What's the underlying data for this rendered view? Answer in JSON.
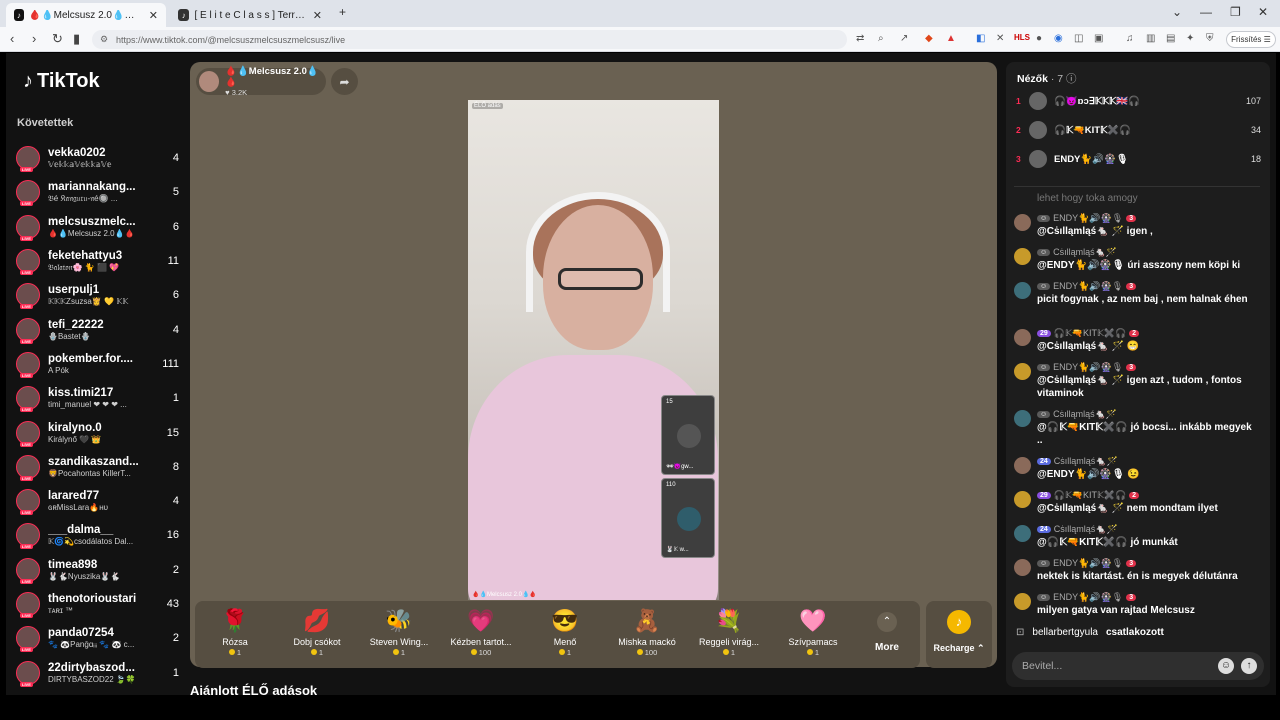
{
  "browser": {
    "tabs": [
      {
        "title": "🩸💧Melcsusz 2.0💧🩸 (@mel",
        "active": true
      },
      {
        "title": "[ E l i t e  C l a s s ] TerrorM",
        "active": false
      }
    ],
    "new_tab": "+",
    "url": "https://www.tiktok.com/@melcsuszmelcsuszmelcsusz/live",
    "update_button": "Frissítés"
  },
  "sidebar": {
    "logo": "TikTok",
    "following_header": "Követettek",
    "items": [
      {
        "name": "vekka0202",
        "sub": "𝕍𝕖𝕜𝕜𝕒𝕍𝕖𝕜𝕜𝕒𝕍𝕖",
        "count": "4"
      },
      {
        "name": "mariannakang...",
        "sub": "𝔅é 𝔎𝔞𝔫𝔤𝔲𝔯𝔲-𝔫é🔘 ...",
        "count": "5"
      },
      {
        "name": "melcsuszmelc...",
        "sub": "🩸💧Melcsusz 2.0💧🩸",
        "count": "6"
      },
      {
        "name": "feketehattyu3",
        "sub": "𝔅𝔞𝔩𝔞𝔱𝔬𝔫🌸 🐈 ⬛ 💖",
        "count": "11"
      },
      {
        "name": "userpulj1",
        "sub": "𝕂𝕂𝕂Zsuzsa👸 💛 𝕂𝕂",
        "count": "6"
      },
      {
        "name": "tefi_22222",
        "sub": "🪬Bastet🪬",
        "count": "4"
      },
      {
        "name": "pokember.for....",
        "sub": "A Pók",
        "count": "111"
      },
      {
        "name": "kiss.timi217",
        "sub": "timi_manuel ❤ ❤ ❤ ...",
        "count": "1"
      },
      {
        "name": "kiralyno.0",
        "sub": "Királynő 🖤 👑",
        "count": "15"
      },
      {
        "name": "szandikaszand...",
        "sub": "🦁Pocahontas KillerT...",
        "count": "8"
      },
      {
        "name": "larared77",
        "sub": "ɢʀMissLara🔥ʜᴜ",
        "count": "4"
      },
      {
        "name": "___dalma__",
        "sub": "𝕂🌀💫csodálatos Dal...",
        "count": "16"
      },
      {
        "name": "timea898",
        "sub": "🐰🐇Nyuszika🐰🐇",
        "count": "2"
      },
      {
        "name": "thenotorioustari",
        "sub": "ᴛᴀʀɪ ™",
        "count": "43"
      },
      {
        "name": "panda07254",
        "sub": "🐾 🐼Panḡɑᵢᵢᵢ 🐾 🐼 c...",
        "count": "2"
      },
      {
        "name": "22dirtybaszod...",
        "sub": "DIRTYBASZOD22 🍃🍀",
        "count": "1"
      }
    ]
  },
  "stream": {
    "host_name": "🩸💧Melcsusz 2.0💧🩸",
    "host_likes": "3.2K",
    "video_label": "ÉLŐ adás",
    "video_caption": "🩸💧Melcsusz 2.0💧🩸",
    "guests": [
      {
        "count": "15",
        "name": "🕶😈gw..."
      },
      {
        "count": "110",
        "name": "🐰𝕂 w..."
      }
    ]
  },
  "gifts": [
    {
      "label": "Rózsa",
      "price": "1",
      "icon": "🌹"
    },
    {
      "label": "Dobj csókot",
      "price": "1",
      "icon": "💋"
    },
    {
      "label": "Steven Wing...",
      "price": "1",
      "icon": "🐝"
    },
    {
      "label": "Kézben tartot...",
      "price": "100",
      "icon": "💗"
    },
    {
      "label": "Menő",
      "price": "1",
      "icon": "😎"
    },
    {
      "label": "Mishka mackó",
      "price": "100",
      "icon": "🧸"
    },
    {
      "label": "Reggeli virág...",
      "price": "1",
      "icon": "💐"
    },
    {
      "label": "Szívpamacs",
      "price": "1",
      "icon": "🩷"
    }
  ],
  "more_label": "More",
  "recharge_label": "Recharge",
  "recommended": "Ajánlott ÉLŐ adások",
  "chat": {
    "viewers_label": "Nézők",
    "viewers_count": "· 7",
    "top_viewers": [
      {
        "rank": "1",
        "name": "🎧😈ɒɔ∃𝕂𝕂𝕂🇬🇧🎧",
        "score": "107"
      },
      {
        "rank": "2",
        "name": "🎧𝕂🔫KIT𝕂✖️🎧",
        "score": "34"
      },
      {
        "rank": "3",
        "name": "ENDY🐈🔊🎡🎙",
        "score": "18"
      }
    ],
    "faded_line": "lehet hogy toka amogy",
    "messages": [
      {
        "user": "ENDY🐈🔊🎡🎙",
        "lvl": "",
        "fan": "3",
        "text": "@Cṡılląmląś🐁 🪄 igen ,"
      },
      {
        "user": "Cṡılląmląś🐁🪄",
        "lvl": "",
        "fan": "",
        "text": "@ENDY🐈🔊🎡🎙 úri asszony nem köpi ki"
      },
      {
        "user": "ENDY🐈🔊🎡🎙",
        "lvl": "",
        "fan": "3",
        "text": "picit fogynak , az nem baj , nem halnak éhen"
      },
      {
        "user": "🎧𝕂🔫KIT𝕂✖️🎧",
        "lvl": "29",
        "fan": "2",
        "text": "@Cṡılląmląś🐁 🪄 😁"
      },
      {
        "user": "ENDY🐈🔊🎡🎙",
        "lvl": "",
        "fan": "3",
        "text": "@Cṡılląmląś🐁 🪄 igen azt , tudom , fontos vitaminok"
      },
      {
        "user": "Cṡılląmląś🐁🪄",
        "lvl": "",
        "fan": "",
        "text": "@🎧𝕂🔫KIT𝕂✖️🎧 jó bocsi... inkább megyek .."
      },
      {
        "user": "Cṡılląmląś🐁🪄",
        "lvl": "24",
        "fan": "",
        "text": "@ENDY🐈🔊🎡🎙 😉"
      },
      {
        "user": "🎧𝕂🔫KIT𝕂✖️🎧",
        "lvl": "29",
        "fan": "2",
        "text": "@Cṡılląmląś🐁 🪄 nem mondtam ilyet"
      },
      {
        "user": "Cṡılląmląś🐁🪄",
        "lvl": "24",
        "fan": "",
        "text": "@🎧𝕂🔫KIT𝕂✖️🎧 jó munkát"
      },
      {
        "user": "ENDY🐈🔊🎡🎙",
        "lvl": "",
        "fan": "3",
        "text": "nektek is kitartást. én is megyek délutánra"
      },
      {
        "user": "ENDY🐈🔊🎡🎙",
        "lvl": "",
        "fan": "3",
        "text": "milyen gatya van rajtad Melcsusz"
      }
    ],
    "joined_user": "bellarbertgyula",
    "joined_text": "csatlakozott",
    "input_placeholder": "Bevitel..."
  }
}
